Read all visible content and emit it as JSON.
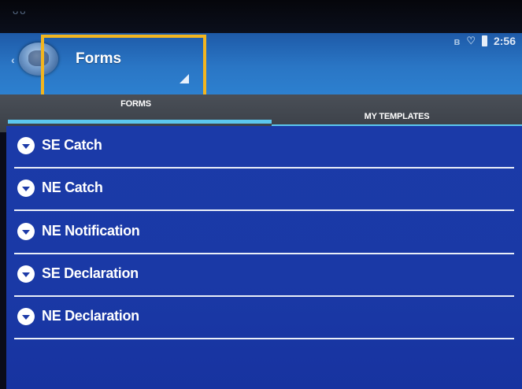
{
  "status_bar": {
    "time": "2:56",
    "left_icons": "ᴗᴗ",
    "icons": [
      "bluetooth-icon",
      "wifi-icon",
      "battery-icon"
    ]
  },
  "action_bar": {
    "spinner_value": "Forms"
  },
  "tabs": [
    {
      "label": "FORMS",
      "selected": true
    },
    {
      "label": "MY TEMPLATES",
      "selected": false
    }
  ],
  "forms_list": [
    {
      "label": "SE Catch"
    },
    {
      "label": "NE Catch"
    },
    {
      "label": "NE Notification"
    },
    {
      "label": "SE Declaration"
    },
    {
      "label": "NE Declaration"
    }
  ],
  "colors": {
    "accent": "#5cc7ee",
    "highlight": "#f2b51f",
    "list_background": "#1b3aa8",
    "action_bar": "#2a76c5"
  }
}
